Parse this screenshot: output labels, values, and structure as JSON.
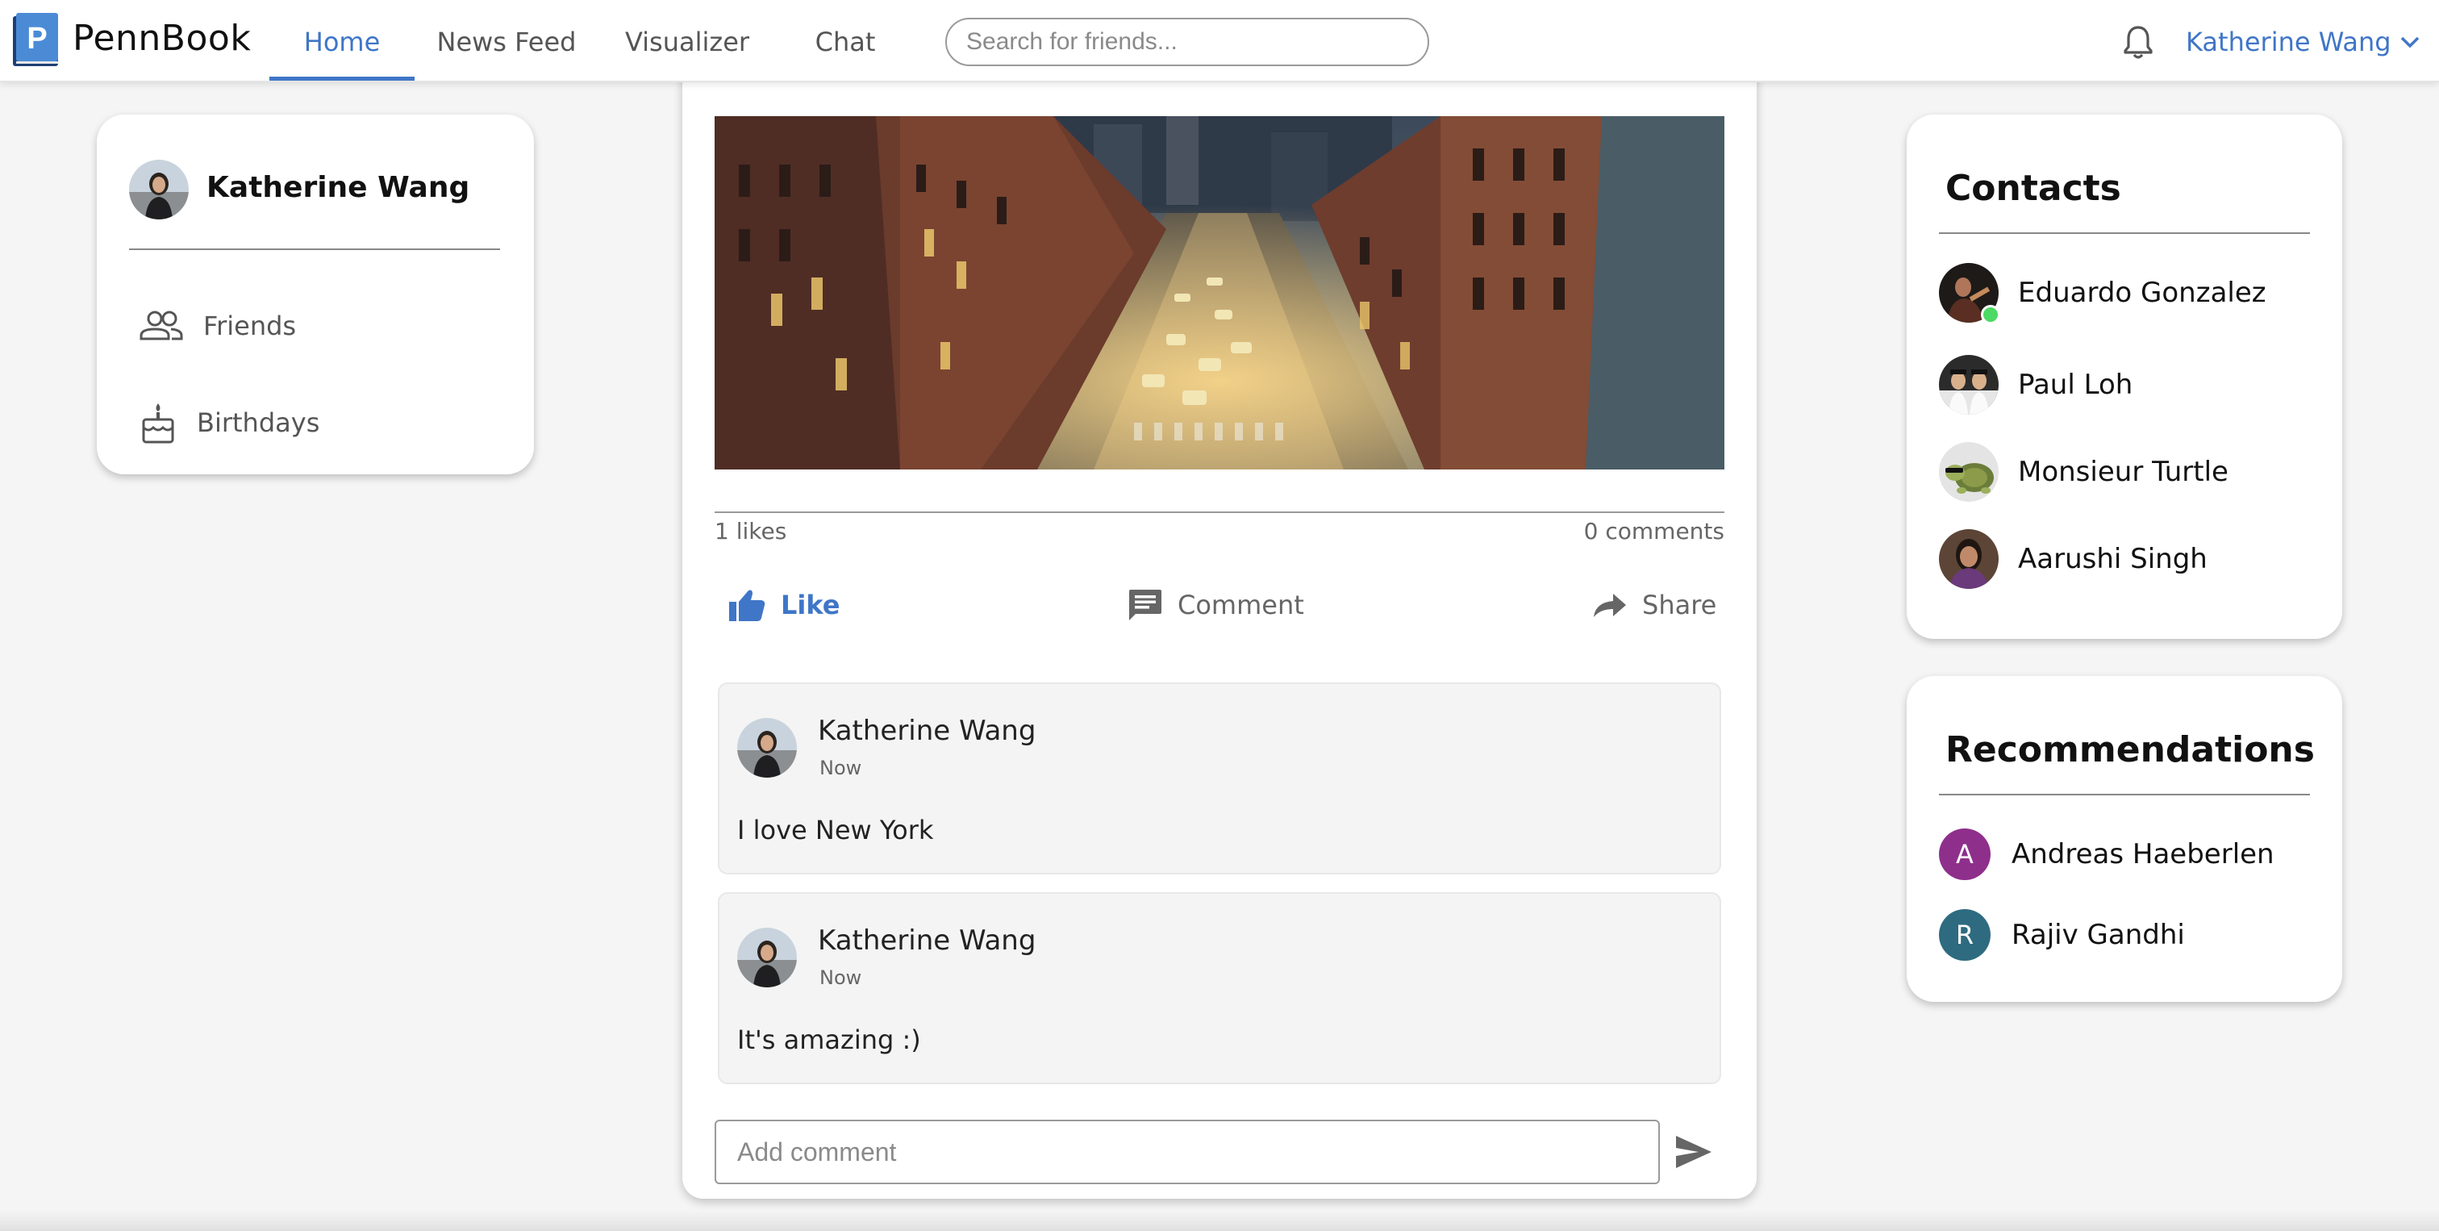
{
  "app": {
    "brand": "PennBook",
    "logo_letter": "P"
  },
  "nav": {
    "tabs": [
      {
        "label": "Home",
        "active": true
      },
      {
        "label": "News Feed",
        "active": false
      },
      {
        "label": "Visualizer",
        "active": false
      },
      {
        "label": "Chat",
        "active": false
      }
    ],
    "search_placeholder": "Search for friends...",
    "user_name": "Katherine Wang"
  },
  "sidebar": {
    "profile_name": "Katherine Wang",
    "items": [
      {
        "label": "Friends",
        "icon": "friends-icon"
      },
      {
        "label": "Birthdays",
        "icon": "cake-icon"
      }
    ]
  },
  "post": {
    "likes_count": "1 likes",
    "comments_count": "0 comments",
    "actions": {
      "like": "Like",
      "comment": "Comment",
      "share": "Share"
    },
    "comments": [
      {
        "author": "Katherine Wang",
        "time": "Now",
        "text": "I love New York"
      },
      {
        "author": "Katherine Wang",
        "time": "Now",
        "text": "It's amazing :)"
      }
    ],
    "add_comment_placeholder": "Add comment"
  },
  "contacts": {
    "title": "Contacts",
    "people": [
      {
        "name": "Eduardo Gonzalez",
        "online": true
      },
      {
        "name": "Paul Loh",
        "online": false
      },
      {
        "name": "Monsieur Turtle",
        "online": false
      },
      {
        "name": "Aarushi Singh",
        "online": false
      }
    ]
  },
  "recommendations": {
    "title": "Recommendations",
    "people": [
      {
        "name": "Andreas Haeberlen",
        "initial": "A",
        "color": "#8e2f8c"
      },
      {
        "name": "Rajiv Gandhi",
        "initial": "R",
        "color": "#2e6b80"
      }
    ]
  },
  "colors": {
    "accent": "#3f76c7",
    "online": "#4cd964"
  }
}
